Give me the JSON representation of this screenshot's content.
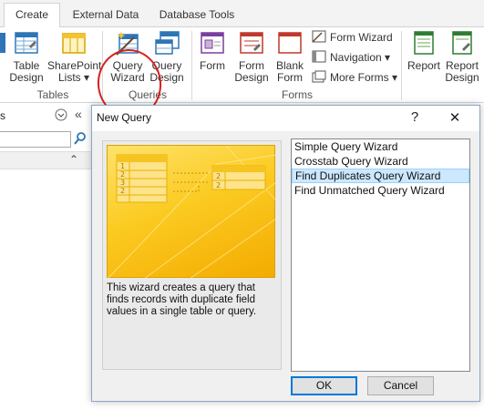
{
  "ribbon": {
    "tabs": [
      {
        "label": "Create",
        "active": true
      },
      {
        "label": "External Data",
        "active": false
      },
      {
        "label": "Database Tools",
        "active": false
      }
    ],
    "groups": {
      "tables": {
        "label": "Tables",
        "buttons": [
          "Table\nDesign",
          "SharePoint\nLists ▾"
        ]
      },
      "queries": {
        "label": "Queries",
        "buttons": [
          "Query\nWizard",
          "Query\nDesign"
        ]
      },
      "forms": {
        "label": "Forms",
        "buttons": [
          "Form",
          "Form\nDesign",
          "Blank\nForm"
        ],
        "small_buttons": [
          "Form Wizard",
          "Navigation ▾",
          "More Forms ▾"
        ]
      },
      "reports": {
        "buttons": [
          "Report",
          "Report\nDesign"
        ]
      }
    },
    "annotation_color": "#d4211f"
  },
  "nav_pane": {
    "header_fragment": "s",
    "icons": [
      "dropdown-circle-icon",
      "collapse-chevrons-icon",
      "search-icon",
      "expand-up-icon"
    ]
  },
  "dialog": {
    "title": "New Query",
    "help_glyph": "?",
    "close_glyph": "✕",
    "description": "This wizard creates a query that finds records with duplicate field values in a single table or query.",
    "preview_values": [
      "1",
      "2",
      "3",
      "2",
      "2",
      "2"
    ],
    "wizards": [
      {
        "label": "Simple Query Wizard",
        "selected": false
      },
      {
        "label": "Crosstab Query Wizard",
        "selected": false
      },
      {
        "label": "Find Duplicates Query Wizard",
        "selected": true
      },
      {
        "label": "Find Unmatched Query Wizard",
        "selected": false
      }
    ],
    "ok_label": "OK",
    "cancel_label": "Cancel",
    "accent_color": "#0078d7",
    "selection_color": "#cce8ff"
  }
}
